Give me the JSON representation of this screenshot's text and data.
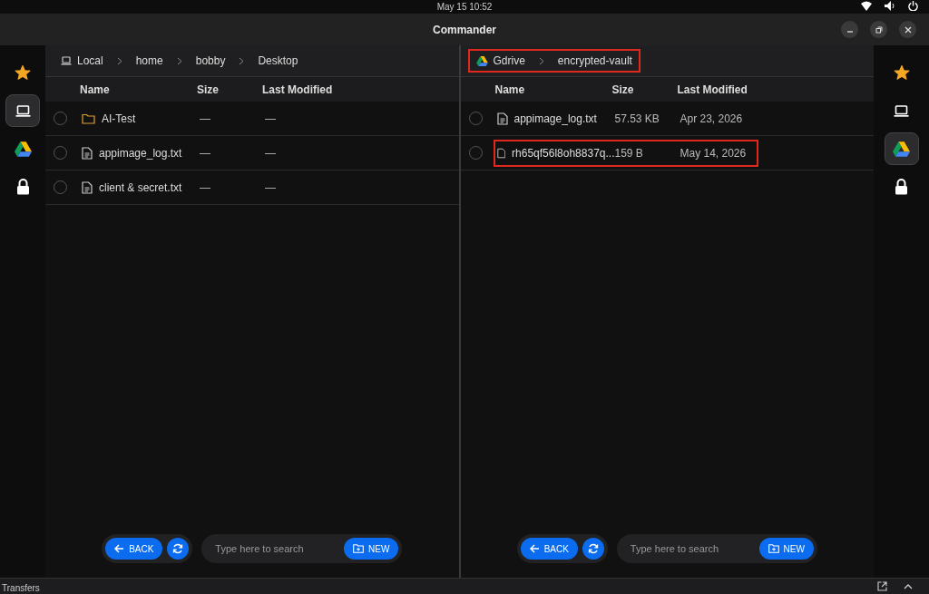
{
  "top_bar": {
    "clock": "May 15  10:52"
  },
  "window": {
    "title": "Commander"
  },
  "left_rail": [
    {
      "kind": "star",
      "selected": false
    },
    {
      "kind": "laptop",
      "selected": true
    },
    {
      "kind": "gdrive",
      "selected": false
    },
    {
      "kind": "lock",
      "selected": false
    }
  ],
  "panes": [
    {
      "breadcrumb": {
        "kind": "local",
        "items": [
          "Local",
          "home",
          "bobby",
          "Desktop"
        ]
      },
      "highlighted": false,
      "columns": [
        "Name",
        "Size",
        "Last Modified"
      ],
      "rows": [
        {
          "kind": "folder",
          "name": "AI-Test",
          "size": "—",
          "modified": "—",
          "checked": false,
          "highlighted": false
        },
        {
          "kind": "text-file",
          "name": "appimage_log.txt",
          "size": "—",
          "modified": "—",
          "checked": false,
          "highlighted": false
        },
        {
          "kind": "text-file",
          "name": "client & secret.txt",
          "size": "—",
          "modified": "—",
          "checked": false,
          "highlighted": false
        }
      ],
      "back": "BACK",
      "search_placeholder": "Type here to search",
      "new": "NEW"
    },
    {
      "breadcrumb": {
        "kind": "gdrive",
        "items": [
          "Gdrive",
          "encrypted-vault"
        ]
      },
      "highlighted": true,
      "columns": [
        "Name",
        "Size",
        "Last Modified"
      ],
      "rows": [
        {
          "kind": "text-file",
          "name": "appimage_log.txt",
          "size": "57.53 KB",
          "modified": "Apr 23, 2026",
          "checked": false,
          "highlighted": false
        },
        {
          "kind": "file",
          "name": "rh65qf56l8oh8837q...",
          "size": "159 B",
          "modified": "May 14, 2026",
          "checked": false,
          "highlighted": true
        }
      ],
      "back": "BACK",
      "search_placeholder": "Type here to search",
      "new": "NEW"
    }
  ],
  "right_rail": [
    {
      "kind": "star",
      "selected": false
    },
    {
      "kind": "laptop",
      "selected": false
    },
    {
      "kind": "gdrive",
      "selected": true
    },
    {
      "kind": "lock",
      "selected": false
    }
  ],
  "transfers": {
    "title": "Transfers"
  }
}
